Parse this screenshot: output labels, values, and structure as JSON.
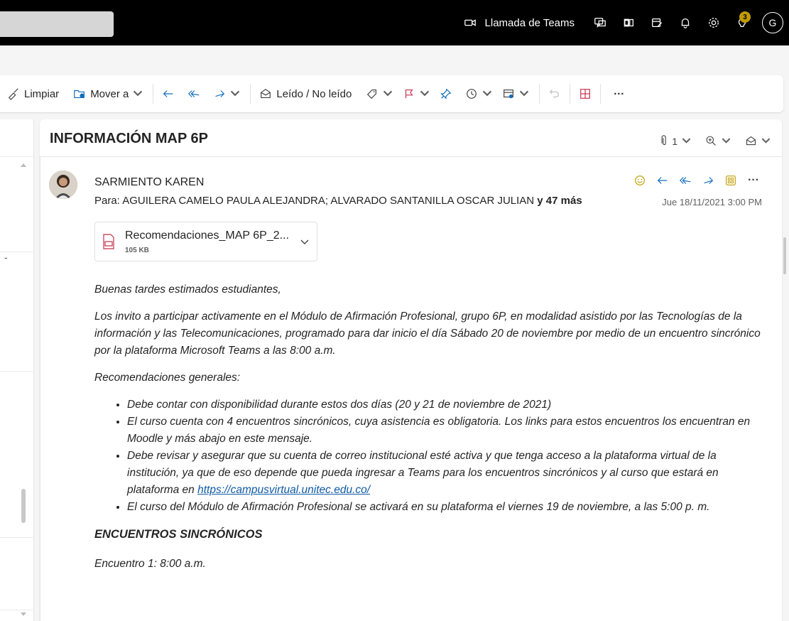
{
  "topbar": {
    "teams_call_label": "Llamada de Teams",
    "notification_badge": "3",
    "avatar_initial": "G"
  },
  "toolbar": {
    "clear_label": "Limpiar",
    "move_label": "Mover a",
    "read_unread_label": "Leído / No leído",
    "more_label": "···"
  },
  "message": {
    "subject": "INFORMACIÓN MAP 6P",
    "attachment_count": "1",
    "sender": "SARMIENTO KAREN",
    "to_prefix": "Para:",
    "to_recipients": "AGUILERA CAMELO PAULA ALEJANDRA;  ALVARADO SANTANILLA OSCAR JULIAN",
    "to_more": "y 47 más",
    "date": "Jue 18/11/2021 3:00 PM",
    "more_actions": "···"
  },
  "attachment": {
    "name": "Recomendaciones_MAP 6P_2...",
    "size": "105 KB"
  },
  "body": {
    "greeting": "Buenas tardes estimados estudiantes,",
    "para1": "Los invito a participar activamente en el Módulo de Afirmación Profesional, grupo 6P, en modalidad asistido por las Tecnologías de la información y las Telecomunicaciones, programado para dar inicio el día Sábado 20 de noviembre por medio de un encuentro sincrónico por la plataforma Microsoft Teams a las 8:00 a.m.",
    "recs_title": "Recomendaciones generales:",
    "bullet1": "Debe contar con disponibilidad durante estos dos días (20 y 21 de noviembre de 2021)",
    "bullet2": "El curso cuenta con 4 encuentros sincrónicos, cuya asistencia es obligatoria. Los links para estos encuentros los encuentran en Moodle y más abajo en este mensaje.",
    "bullet3_text": "Debe revisar y asegurar que su cuenta de correo institucional esté activa y que tenga acceso a la plataforma virtual de la institución, ya que de eso depende que pueda ingresar a Teams para los encuentros sincrónicos y al curso que estará en plataforma en ",
    "bullet3_link": "https://campusvirtual.unitec.edu.co/",
    "bullet4": "El curso del Módulo de Afirmación Profesional se activará en su plataforma el viernes 19 de noviembre, a las 5:00 p. m.",
    "sync_heading": "ENCUENTROS SINCRÓNICOS",
    "encuentro1": "Encuentro 1: 8:00 a.m."
  }
}
